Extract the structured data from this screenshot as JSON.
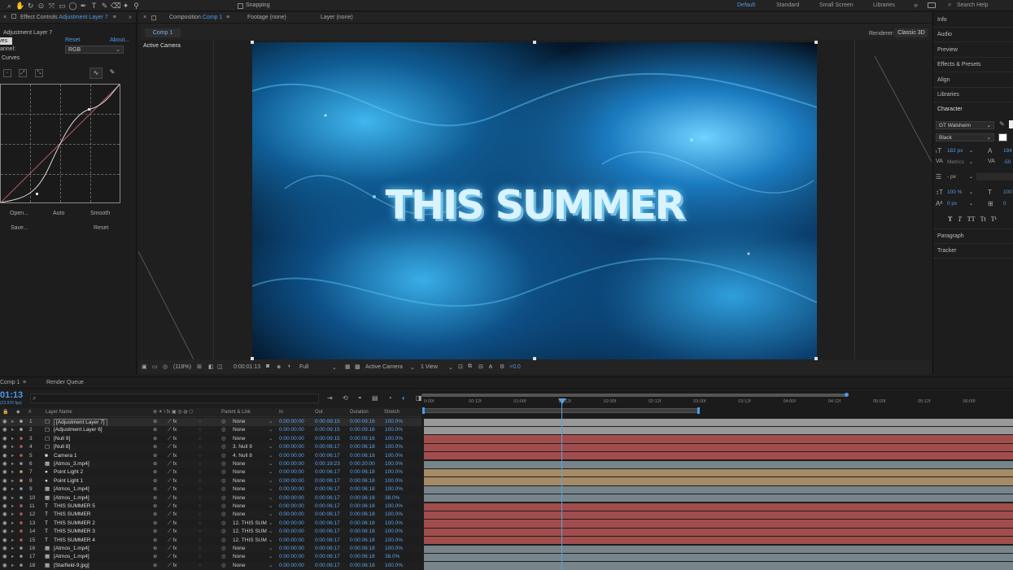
{
  "toolbar": {
    "snapping_label": "Snapping",
    "workspaces": [
      "Default",
      "Standard",
      "Small Screen",
      "Libraries"
    ],
    "search_placeholder": "Search Help",
    "tool_icons": [
      "search-icon",
      "hand-icon",
      "rotate-icon",
      "camera-icon",
      "pan-icon",
      "rect-icon",
      "ellipse-icon",
      "pen-icon",
      "type-icon",
      "brush-icon",
      "eraser-icon",
      "puppet-icon",
      "pin-icon"
    ]
  },
  "effect_controls": {
    "title": "Effect Controls",
    "layer_link": "Adjustment Layer 7",
    "subtitle": "Adjustment Layer 7",
    "effect_name": "Curves",
    "reset": "Reset",
    "about": "About...",
    "channel_label": "annel:",
    "channel_value": "RGB",
    "curves_label": "Curves",
    "buttons": {
      "open": "Open...",
      "auto": "Auto",
      "smooth": "Smooth",
      "save": "Save...",
      "reset": "Reset"
    }
  },
  "composition": {
    "tab_label": "Composition",
    "tab_name": "Comp 1",
    "footage_tab": "Footage (none)",
    "layer_tab": "Layer (none)",
    "breadcrumb": "Comp 1",
    "renderer_label": "Renderer:",
    "renderer_value": "Classic 3D",
    "active_camera": "Active Camera",
    "title_text": "THIS SUMMER",
    "bottom_bar": {
      "zoom": "(118%)",
      "timecode": "0:00:01:13",
      "resolution": "Full",
      "view": "Active Camera",
      "views_count": "1 View",
      "exposure": "+0.0"
    }
  },
  "right_panel": {
    "sections": [
      "Info",
      "Audio",
      "Preview",
      "Effects & Presets",
      "Align",
      "Libraries",
      "Character"
    ],
    "font": "GT Walsheim",
    "style": "Black",
    "font_size": "182 px",
    "leading": "184",
    "kerning": "Metrics",
    "tracking": "-50",
    "stroke": "- px",
    "vscale": "100 %",
    "hscale": "100",
    "baseline": "0 px",
    "tsume": "0",
    "text_styles": [
      "T",
      "T",
      "TT",
      "Tt",
      "T¹"
    ],
    "lower_sections": [
      "Paragraph",
      "Tracker"
    ]
  },
  "timeline": {
    "tab_label": "Comp 1",
    "render_queue": "Render Queue",
    "timecode": "01:13",
    "fps": "(23.976 fps)",
    "search_placeholder": "",
    "columns": {
      "layer_name": "Layer Name",
      "parent": "Parent & Link",
      "in": "In",
      "out": "Out",
      "duration": "Duration",
      "stretch": "Stretch"
    },
    "ruler": [
      "0:00f",
      "00:12f",
      "01:00f",
      "01:12f",
      "02:00f",
      "02:12f",
      "03:00f",
      "03:12f",
      "04:00f",
      "04:12f",
      "05:00f",
      "05:12f",
      "06:00f"
    ],
    "layers": [
      {
        "num": "1",
        "type": "▢",
        "name": "[Adjustment Layer 7]",
        "parent": "None",
        "in": "0:00:00:00",
        "out": "0:00:09:15",
        "dur": "0:00:09:16",
        "stretch": "100.0%",
        "color": "#b8b8b8"
      },
      {
        "num": "2",
        "type": "▢",
        "name": "[Adjustment Layer 6]",
        "parent": "None",
        "in": "0:00:00:00",
        "out": "0:00:09:15",
        "dur": "0:00:09:16",
        "stretch": "100.0%",
        "color": "#b8b8b8"
      },
      {
        "num": "3",
        "type": "▢",
        "name": "[Null 9]",
        "parent": "None",
        "in": "0:00:00:00",
        "out": "0:00:09:15",
        "dur": "0:00:09:16",
        "stretch": "100.0%",
        "color": "#c45a5a"
      },
      {
        "num": "4",
        "type": "▢",
        "name": "[Null 8]",
        "parent": "3. Null 9",
        "in": "0:00:00:00",
        "out": "0:00:06:17",
        "dur": "0:00:06:18",
        "stretch": "100.0%",
        "color": "#c45a5a"
      },
      {
        "num": "5",
        "type": "■",
        "name": "Camera 1",
        "parent": "4. Null 8",
        "in": "0:00:00:00",
        "out": "0:00:06:17",
        "dur": "0:00:06:18",
        "stretch": "100.0%",
        "color": "#c45a5a"
      },
      {
        "num": "6",
        "type": "▦",
        "name": "[Atmos_3.mp4]",
        "parent": "None",
        "in": "0:00:00:00",
        "out": "0:00:19:23",
        "dur": "0:00:20:00",
        "stretch": "100.0%",
        "color": "#8fa0a8"
      },
      {
        "num": "7",
        "type": "●",
        "name": "Point Light 2",
        "parent": "None",
        "in": "0:00:00:00",
        "out": "0:00:06:17",
        "dur": "0:00:06:18",
        "stretch": "100.0%",
        "color": "#c9a87a"
      },
      {
        "num": "8",
        "type": "●",
        "name": "Point Light 1",
        "parent": "None",
        "in": "0:00:00:00",
        "out": "0:00:06:17",
        "dur": "0:00:06:18",
        "stretch": "100.0%",
        "color": "#c9a87a"
      },
      {
        "num": "9",
        "type": "▦",
        "name": "[Atmos_1.mp4]",
        "parent": "None",
        "in": "0:00:00:00",
        "out": "0:00:06:17",
        "dur": "0:00:06:18",
        "stretch": "100.0%",
        "color": "#8fa0a8"
      },
      {
        "num": "10",
        "type": "▦",
        "name": "[Atmos_1.mp4]",
        "parent": "None",
        "in": "0:00:00:00",
        "out": "0:00:06:17",
        "dur": "0:00:06:18",
        "stretch": "38.0%",
        "color": "#8fa0a8"
      },
      {
        "num": "11",
        "type": "T",
        "name": "THIS SUMMER 5",
        "parent": "None",
        "in": "0:00:00:00",
        "out": "0:00:06:17",
        "dur": "0:00:06:18",
        "stretch": "100.0%",
        "color": "#c45a5a"
      },
      {
        "num": "12",
        "type": "T",
        "name": "THIS SUMMER",
        "parent": "None",
        "in": "0:00:00:00",
        "out": "0:00:06:17",
        "dur": "0:00:06:18",
        "stretch": "100.0%",
        "color": "#c45a5a"
      },
      {
        "num": "13",
        "type": "T",
        "name": "THIS SUMMER 2",
        "parent": "12. THIS SUM",
        "in": "0:00:00:00",
        "out": "0:00:06:17",
        "dur": "0:00:06:18",
        "stretch": "100.0%",
        "color": "#c45a5a"
      },
      {
        "num": "14",
        "type": "T",
        "name": "THIS SUMMER 3",
        "parent": "12. THIS SUM",
        "in": "0:00:00:00",
        "out": "0:00:06:17",
        "dur": "0:00:06:18",
        "stretch": "100.0%",
        "color": "#c45a5a"
      },
      {
        "num": "15",
        "type": "T",
        "name": "THIS SUMMER 4",
        "parent": "12. THIS SUM",
        "in": "0:00:00:00",
        "out": "0:00:06:17",
        "dur": "0:00:06:18",
        "stretch": "100.0%",
        "color": "#c45a5a"
      },
      {
        "num": "16",
        "type": "▦",
        "name": "[Atmos_1.mp4]",
        "parent": "None",
        "in": "0:00:00:00",
        "out": "0:00:06:17",
        "dur": "0:00:06:18",
        "stretch": "100.0%",
        "color": "#8fa0a8"
      },
      {
        "num": "17",
        "type": "▦",
        "name": "[Atmos_1.mp4]",
        "parent": "None",
        "in": "0:00:00:00",
        "out": "0:00:06:17",
        "dur": "0:00:06:18",
        "stretch": "38.0%",
        "color": "#8fa0a8"
      },
      {
        "num": "18",
        "type": "▦",
        "name": "[Starfield-9.jpg]",
        "parent": "None",
        "in": "0:00:00:00",
        "out": "0:00:06:17",
        "dur": "0:00:06:18",
        "stretch": "100.0%",
        "color": "#8fa0a8"
      }
    ]
  }
}
